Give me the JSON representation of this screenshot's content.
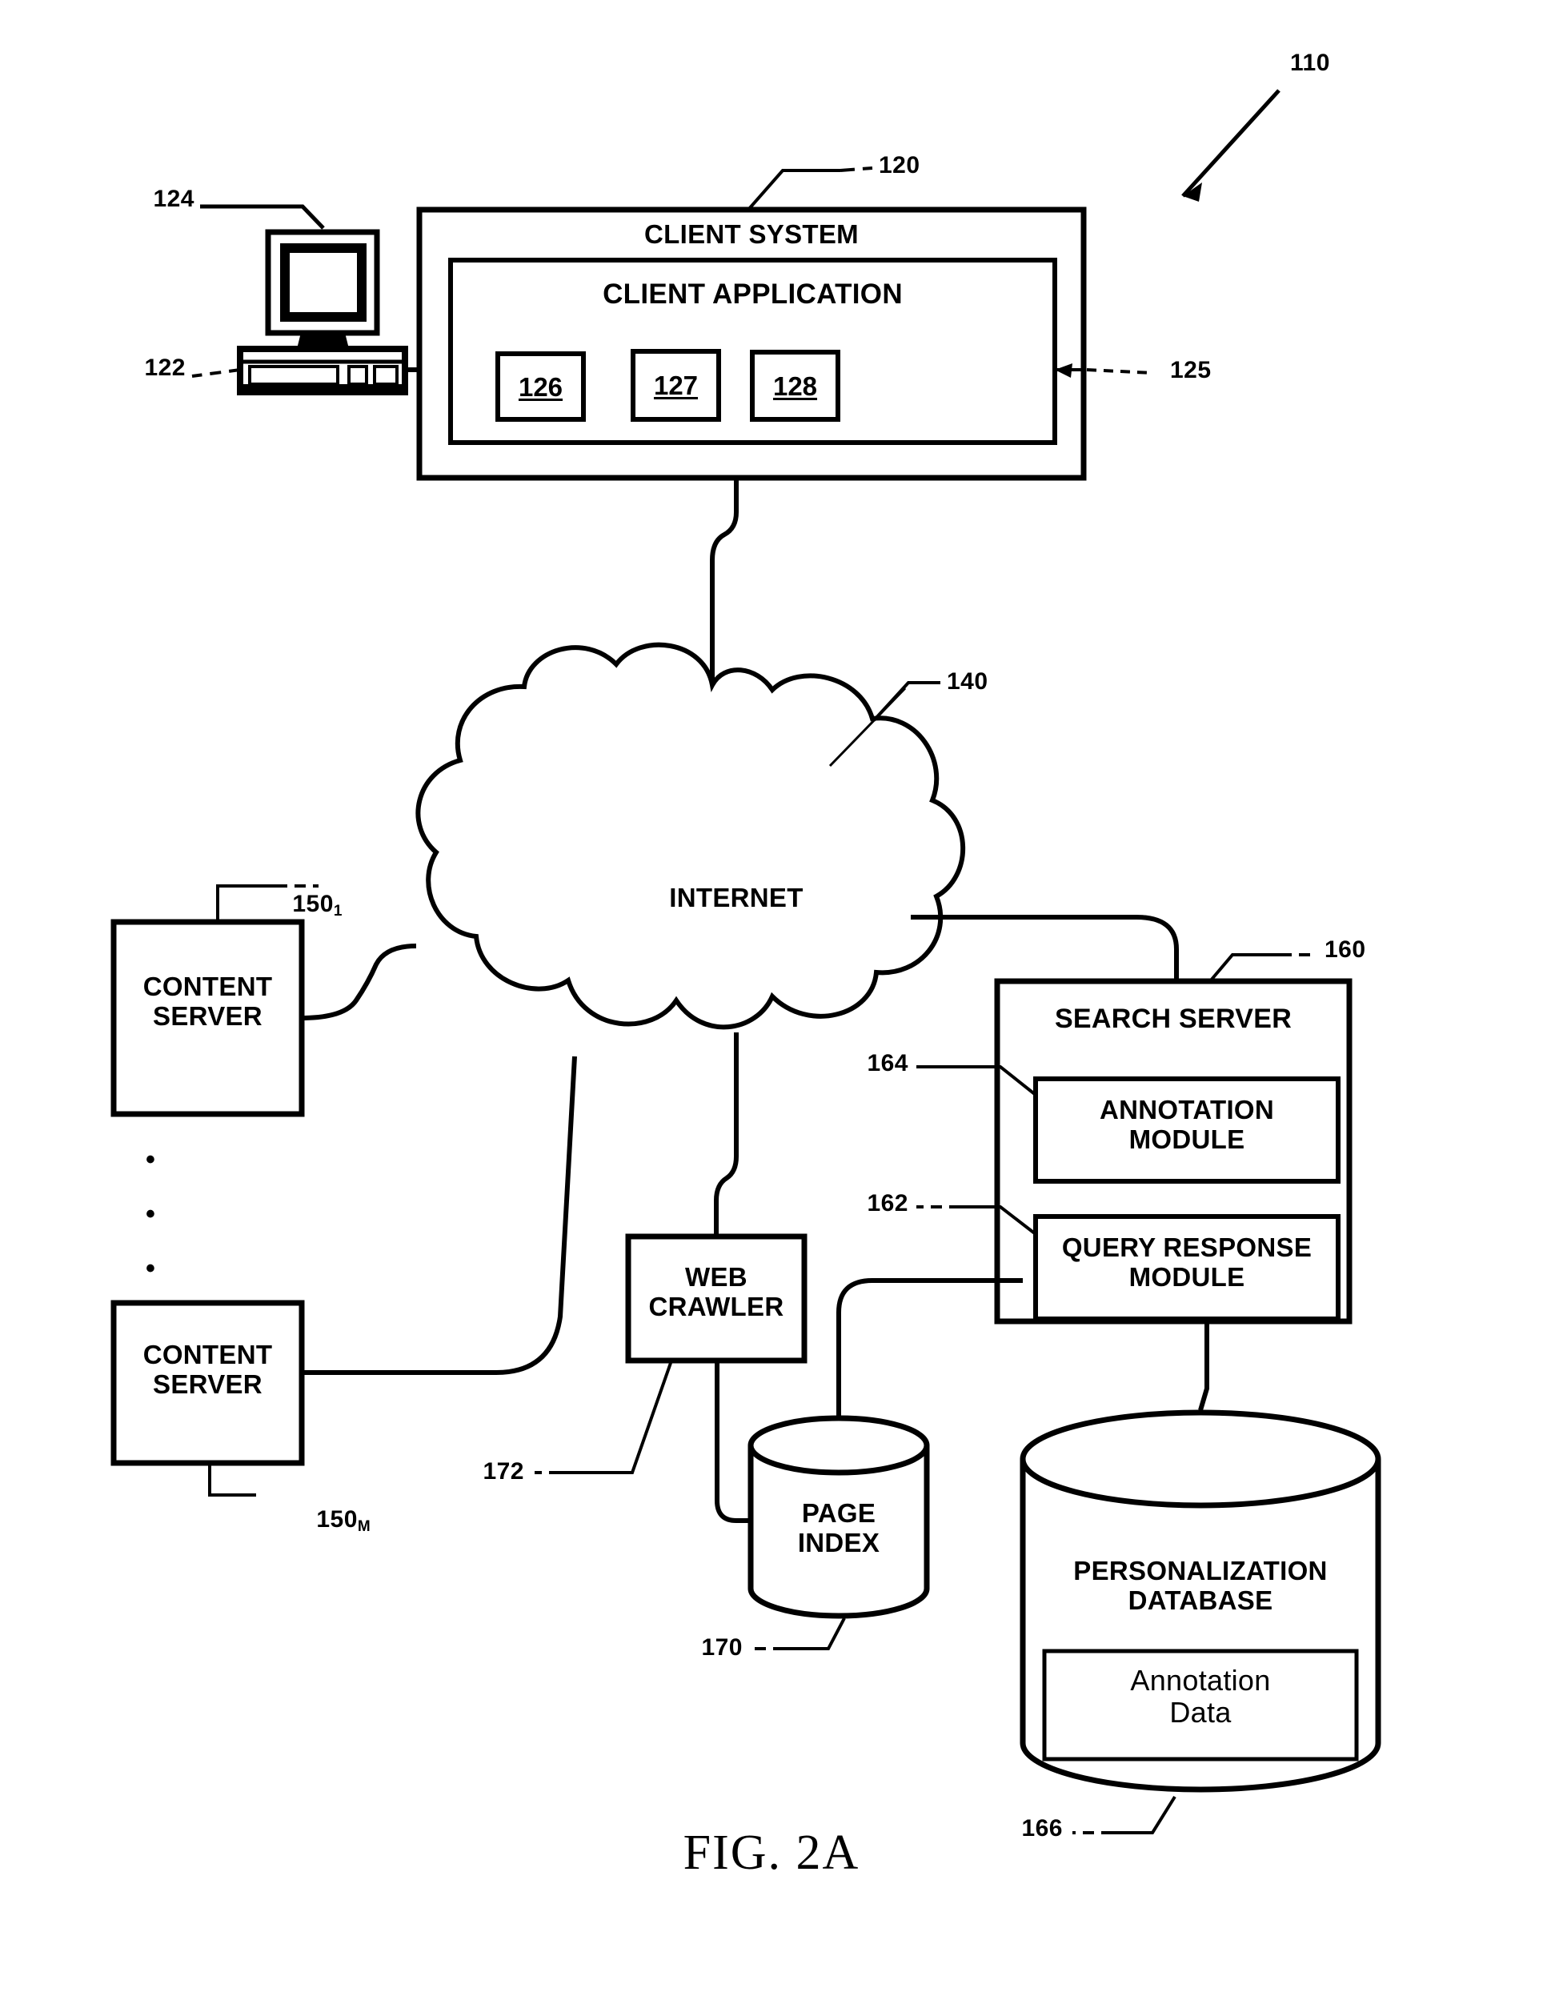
{
  "figure": {
    "caption": "FIG. 2A",
    "system_ref": "110"
  },
  "client": {
    "system_title": "CLIENT SYSTEM",
    "system_ref": "120",
    "application_title": "CLIENT APPLICATION",
    "application_ref": "125",
    "monitor_ref": "124",
    "computer_ref": "122",
    "modules": [
      {
        "number": "126"
      },
      {
        "number": "127"
      },
      {
        "number": "128"
      }
    ]
  },
  "network": {
    "label": "INTERNET",
    "ref": "140"
  },
  "content_servers": [
    {
      "line1": "CONTENT",
      "line2": "SERVER",
      "ref": "150",
      "ref_sub": "1"
    },
    {
      "line1": "CONTENT",
      "line2": "SERVER",
      "ref": "150",
      "ref_sub": "M"
    }
  ],
  "ellipsis": "•\n\n•\n\n•",
  "web_crawler": {
    "line1": "WEB",
    "line2": "CRAWLER",
    "ref": "172"
  },
  "page_index": {
    "line1": "PAGE",
    "line2": "INDEX",
    "ref": "170"
  },
  "search_server": {
    "title": "SEARCH SERVER",
    "ref": "160",
    "annotation_module": {
      "line1": "ANNOTATION",
      "line2": "MODULE",
      "ref": "164"
    },
    "query_response_module": {
      "line1": "QUERY RESPONSE",
      "line2": "MODULE",
      "ref": "162"
    }
  },
  "personalization_database": {
    "line1": "PERSONALIZATION",
    "line2": "DATABASE",
    "inner_line1": "Annotation",
    "inner_line2": "Data",
    "ref": "166"
  },
  "colors": {
    "ink": "#000000",
    "paper": "#ffffff"
  }
}
